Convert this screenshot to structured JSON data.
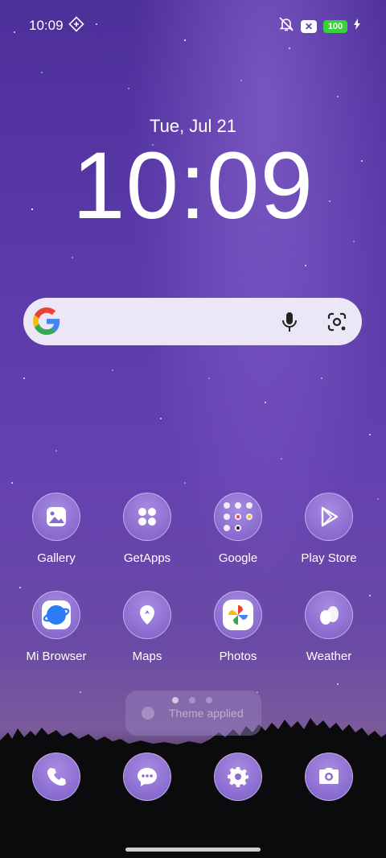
{
  "status_bar": {
    "time": "10:09",
    "battery": "100",
    "icons": [
      "nfc-icon",
      "mute-icon",
      "close-box-icon",
      "battery-icon",
      "charging-icon"
    ]
  },
  "lockclock": {
    "date": "Tue, Jul 21",
    "time": "10:09"
  },
  "search": {
    "icons": [
      "google-logo-icon",
      "mic-icon",
      "google-lens-icon"
    ]
  },
  "apps": [
    {
      "label": "Gallery",
      "icon": "gallery-icon"
    },
    {
      "label": "GetApps",
      "icon": "getapps-icon"
    },
    {
      "label": "Google",
      "icon": "google-folder-icon"
    },
    {
      "label": "Play Store",
      "icon": "play-store-icon"
    },
    {
      "label": "Mi Browser",
      "icon": "browser-icon"
    },
    {
      "label": "Maps",
      "icon": "maps-icon"
    },
    {
      "label": "Photos",
      "icon": "photos-icon"
    },
    {
      "label": "Weather",
      "icon": "weather-icon"
    }
  ],
  "toast": {
    "text": "Theme applied"
  },
  "page_indicator": {
    "count": 3,
    "active": 0
  },
  "dock": [
    {
      "icon": "phone-icon"
    },
    {
      "icon": "messages-icon"
    },
    {
      "icon": "settings-icon"
    },
    {
      "icon": "camera-icon"
    }
  ],
  "colors": {
    "accent": "#8a6bd0",
    "battery": "#3bd13b"
  }
}
